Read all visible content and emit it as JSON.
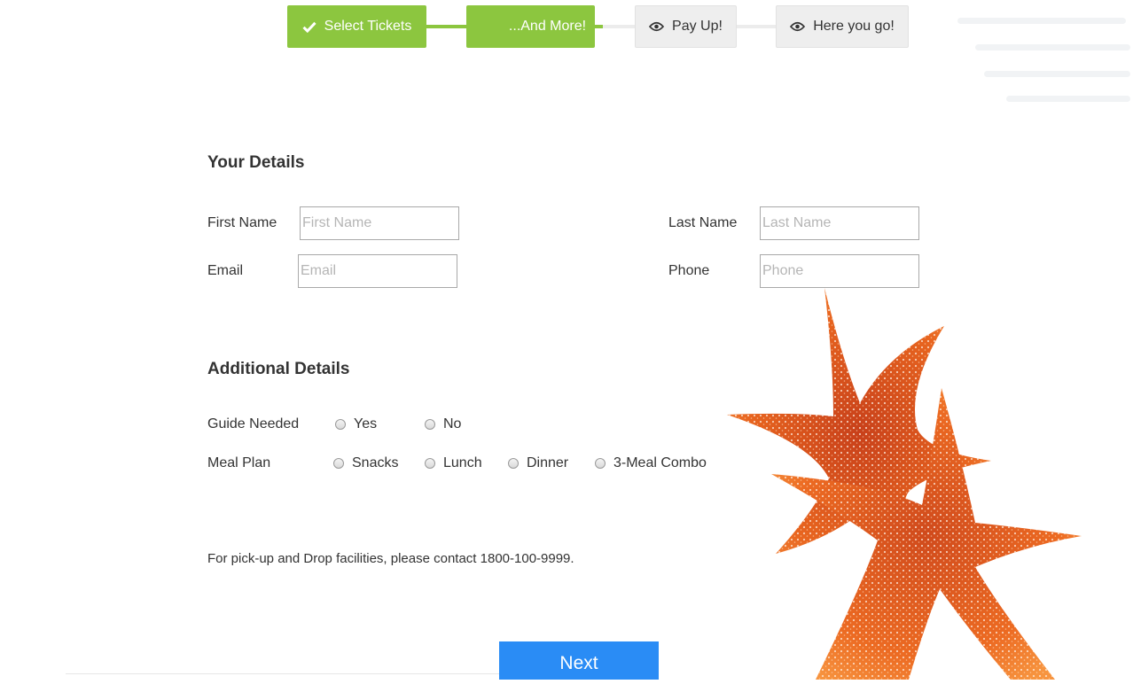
{
  "stepper": {
    "steps": [
      {
        "label": "Select Tickets",
        "icon": "check-icon",
        "state": "completed"
      },
      {
        "label": "...And More!",
        "icon": "",
        "state": "active"
      },
      {
        "label": "Pay Up!",
        "icon": "eye-icon",
        "state": "pending"
      },
      {
        "label": "Here you go!",
        "icon": "eye-icon",
        "state": "pending"
      }
    ]
  },
  "your_details": {
    "title": "Your Details",
    "first_name": {
      "label": "First Name",
      "placeholder": "First Name",
      "value": ""
    },
    "last_name": {
      "label": "Last Name",
      "placeholder": "Last Name",
      "value": ""
    },
    "email": {
      "label": "Email",
      "placeholder": "Email",
      "value": ""
    },
    "phone": {
      "label": "Phone",
      "placeholder": "Phone",
      "value": ""
    }
  },
  "additional_details": {
    "title": "Additional Details",
    "guide": {
      "label": "Guide Needed",
      "options": [
        "Yes",
        "No"
      ]
    },
    "meal_plan": {
      "label": "Meal Plan",
      "options": [
        "Snacks",
        "Lunch",
        "Dinner",
        "3-Meal Combo"
      ]
    }
  },
  "note": "For pick-up and Drop facilities, please contact 1800-100-9999.",
  "next_button": "Next",
  "colors": {
    "accent_green": "#8cc63f",
    "button_blue": "#2a8cf5",
    "starfish_orange": "#e8601c"
  }
}
